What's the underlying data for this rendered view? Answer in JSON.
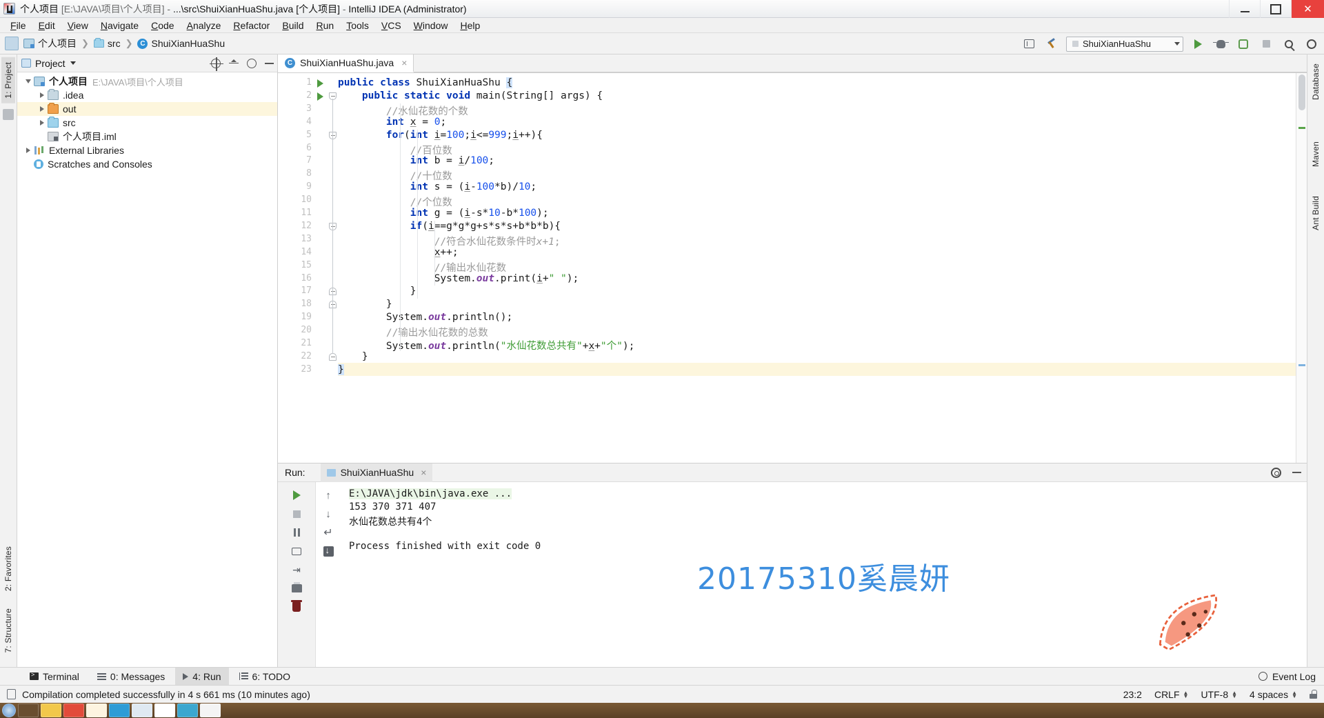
{
  "titlebar": {
    "project": "个人项目",
    "path": "[E:\\JAVA\\项目\\个人项目]",
    "dash1": "-",
    "file": "...\\src\\ShuiXianHuaShu.java",
    "module": "[个人项目]",
    "dash2": "-",
    "app": "IntelliJ IDEA (Administrator)",
    "minimize": "minimize-button",
    "maximize": "maximize-button",
    "close": "close-button"
  },
  "menu": [
    "File",
    "Edit",
    "View",
    "Navigate",
    "Code",
    "Analyze",
    "Refactor",
    "Build",
    "Run",
    "Tools",
    "VCS",
    "Window",
    "Help"
  ],
  "navbar": {
    "crumbs": [
      "个人项目",
      "src",
      "ShuiXianHuaShu"
    ],
    "run_config": "ShuiXianHuaShu",
    "buttons": [
      "run",
      "debug",
      "coverage",
      "stop",
      "search",
      "build",
      "settings"
    ]
  },
  "project_panel": {
    "title": "Project",
    "tree": [
      {
        "indent": 0,
        "arrow": "open",
        "icon": "module",
        "label": "个人项目",
        "bold": true,
        "path": "E:\\JAVA\\项目\\个人项目",
        "highlight": false
      },
      {
        "indent": 1,
        "arrow": "closed",
        "icon": "folder",
        "label": ".idea",
        "bold": false,
        "path": "",
        "highlight": false
      },
      {
        "indent": 1,
        "arrow": "closed",
        "icon": "folder-out",
        "label": "out",
        "bold": false,
        "path": "",
        "highlight": true
      },
      {
        "indent": 1,
        "arrow": "closed",
        "icon": "folder-src",
        "label": "src",
        "bold": false,
        "path": "",
        "highlight": false
      },
      {
        "indent": 1,
        "arrow": "none",
        "icon": "iml",
        "label": "个人项目.iml",
        "bold": false,
        "path": "",
        "highlight": false
      },
      {
        "indent": 0,
        "arrow": "closed",
        "icon": "library",
        "label": "External Libraries",
        "bold": false,
        "path": "",
        "highlight": false
      },
      {
        "indent": 0,
        "arrow": "none",
        "icon": "scratch",
        "label": "Scratches and Consoles",
        "bold": false,
        "path": "",
        "highlight": false
      }
    ]
  },
  "left_strip": {
    "tabs": [
      "1: Project",
      "2: Favorites",
      "7: Structure"
    ]
  },
  "right_strip": {
    "tabs": [
      "Database",
      "Maven",
      "Ant Build"
    ]
  },
  "editor": {
    "tab_name": "ShuiXianHuaShu.java",
    "tab_close": "×",
    "lines": [
      {
        "n": 1,
        "indent": 0,
        "runmark": true,
        "fold": "",
        "html": "<span class=\"kw\">public class</span> ShuiXianHuaShu <span class=\"caretsel\">{</span>"
      },
      {
        "n": 2,
        "indent": 0,
        "runmark": true,
        "fold": "open",
        "html": "    <span class=\"kw\">public static void</span> main(String[] args) {"
      },
      {
        "n": 3,
        "indent": 2,
        "runmark": false,
        "fold": "",
        "html": "        <span class=\"cm\">//水仙花数的个数</span>"
      },
      {
        "n": 4,
        "indent": 2,
        "runmark": false,
        "fold": "",
        "html": "        <span class=\"kw\">int</span> <span class=\"uline\">x</span> = <span class=\"num\">0</span>;"
      },
      {
        "n": 5,
        "indent": 2,
        "runmark": false,
        "fold": "open",
        "html": "        <span class=\"kw\">for</span>(<span class=\"kw\">int</span> <span class=\"uline\">i</span>=<span class=\"num\">100</span>;<span class=\"uline\">i</span>&lt;=<span class=\"num\">999</span>;<span class=\"uline\">i</span>++){"
      },
      {
        "n": 6,
        "indent": 3,
        "runmark": false,
        "fold": "",
        "html": "            <span class=\"cm\">//百位数</span>"
      },
      {
        "n": 7,
        "indent": 3,
        "runmark": false,
        "fold": "",
        "html": "            <span class=\"kw\">int</span> b = <span class=\"uline\">i</span>/<span class=\"num\">100</span>;"
      },
      {
        "n": 8,
        "indent": 3,
        "runmark": false,
        "fold": "",
        "html": "            <span class=\"cm\">//十位数</span>"
      },
      {
        "n": 9,
        "indent": 3,
        "runmark": false,
        "fold": "",
        "html": "            <span class=\"kw\">int</span> s = (<span class=\"uline\">i</span>-<span class=\"num\">100</span>*b)/<span class=\"num\">10</span>;"
      },
      {
        "n": 10,
        "indent": 3,
        "runmark": false,
        "fold": "",
        "html": "            <span class=\"cm\">//个位数</span>"
      },
      {
        "n": 11,
        "indent": 3,
        "runmark": false,
        "fold": "",
        "html": "            <span class=\"kw\">int</span> g = (<span class=\"uline\">i</span>-s*<span class=\"num\">10</span>-b*<span class=\"num\">100</span>);"
      },
      {
        "n": 12,
        "indent": 3,
        "runmark": false,
        "fold": "open",
        "html": "            <span class=\"kw\">if</span>(<span class=\"uline\">i</span>==g*g*g+s*s*s+b*b*b){"
      },
      {
        "n": 13,
        "indent": 4,
        "runmark": false,
        "fold": "",
        "html": "                <span class=\"cm\">//符合水仙花数条件时<i>x+1</i>;</span>"
      },
      {
        "n": 14,
        "indent": 4,
        "runmark": false,
        "fold": "",
        "html": "                <span class=\"uline\">x</span>++;"
      },
      {
        "n": 15,
        "indent": 4,
        "runmark": false,
        "fold": "",
        "html": "                <span class=\"cm\">//输出水仙花数</span>"
      },
      {
        "n": 16,
        "indent": 4,
        "runmark": false,
        "fold": "",
        "html": "                System.<span class=\"fld\">out</span>.print(<span class=\"uline\">i</span>+<span class=\"str\">\" \"</span>);"
      },
      {
        "n": 17,
        "indent": 3,
        "runmark": false,
        "fold": "close",
        "html": "            }"
      },
      {
        "n": 18,
        "indent": 2,
        "runmark": false,
        "fold": "close",
        "html": "        }"
      },
      {
        "n": 19,
        "indent": 2,
        "runmark": false,
        "fold": "",
        "html": "        System.<span class=\"fld\">out</span>.println();"
      },
      {
        "n": 20,
        "indent": 2,
        "runmark": false,
        "fold": "",
        "html": "        <span class=\"cm\">//输出水仙花数的总数</span>"
      },
      {
        "n": 21,
        "indent": 2,
        "runmark": false,
        "fold": "",
        "html": "        System.<span class=\"fld\">out</span>.println(<span class=\"str\">\"水仙花数总共有\"</span>+<span class=\"uline\">x</span>+<span class=\"str\">\"个\"</span>);"
      },
      {
        "n": 22,
        "indent": 1,
        "runmark": false,
        "fold": "close",
        "html": "    }"
      },
      {
        "n": 23,
        "indent": 0,
        "runmark": false,
        "fold": "",
        "html": "<span class=\"caretsel\">}</span>",
        "current": true
      }
    ]
  },
  "run_panel": {
    "label": "Run:",
    "tab_name": "ShuiXianHuaShu",
    "tab_close": "×",
    "console_lines": [
      {
        "text": "E:\\JAVA\\jdk\\bin\\java.exe ...",
        "style": "link"
      },
      {
        "text": "153 370 371 407",
        "style": "plain"
      },
      {
        "text": "水仙花数总共有4个",
        "style": "plain"
      },
      {
        "text": "",
        "style": "plain"
      },
      {
        "text": "Process finished with exit code 0",
        "style": "plain"
      }
    ],
    "watermark": "20175310奚晨妍"
  },
  "bottom_bar": {
    "items": [
      {
        "label": "Terminal",
        "icon": "terminal-icon",
        "selected": false
      },
      {
        "label": "0: Messages",
        "icon": "messages-icon",
        "selected": false
      },
      {
        "label": "4: Run",
        "icon": "run-icon",
        "selected": true
      },
      {
        "label": "6: TODO",
        "icon": "todo-icon",
        "selected": false
      }
    ],
    "event_log": "Event Log"
  },
  "status_bar": {
    "message": "Compilation completed successfully in 4 s 661 ms (10 minutes ago)",
    "caret": "23:2",
    "line_sep": "CRLF",
    "encoding": "UTF-8",
    "indent": "4 spaces"
  },
  "colors": {
    "accent": "#3d8ede",
    "keyword": "#0033b3",
    "string": "#3f9c35",
    "comment": "#9a9a9a",
    "number": "#1750eb",
    "field": "#7a3b9e",
    "highlight_row": "#fdf6dd"
  }
}
